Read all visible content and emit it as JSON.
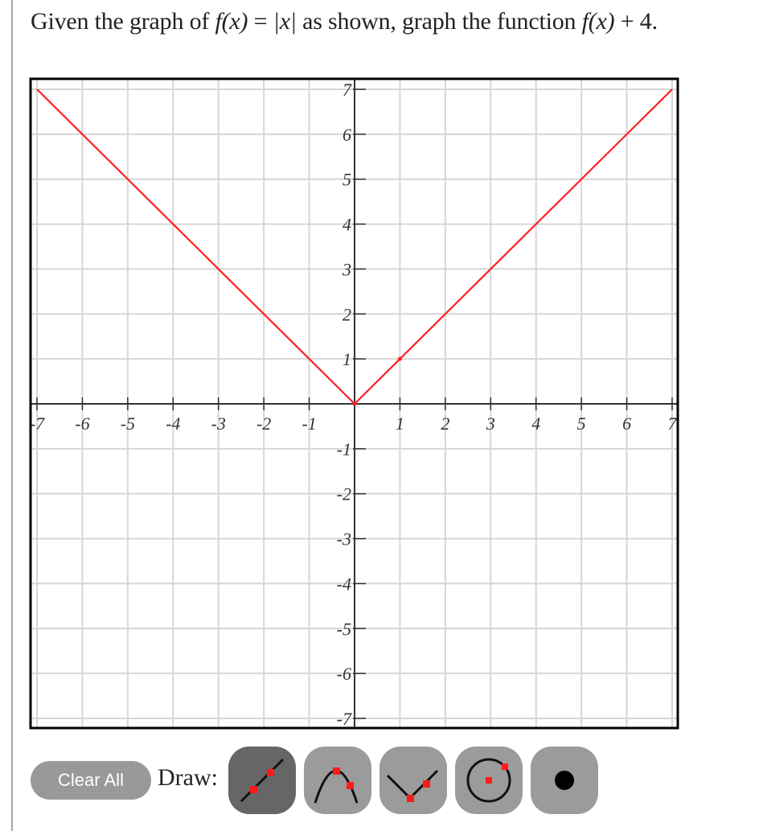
{
  "question": {
    "prefix": "Given the graph of ",
    "f_of_x_1": "f(x)",
    "equals": " = ",
    "abs_x": "|x|",
    "middle": " as shown, graph the function ",
    "f_of_x_2": "f(x)",
    "suffix": " + 4."
  },
  "graph": {
    "x_range": [
      -7,
      7
    ],
    "y_range": [
      -7,
      7
    ],
    "x_tick_labels": [
      "-7",
      "-6",
      "-5",
      "-4",
      "-3",
      "-2",
      "-1",
      "1",
      "2",
      "3",
      "4",
      "5",
      "6",
      "7"
    ],
    "y_tick_labels": [
      "7",
      "6",
      "5",
      "4",
      "3",
      "2",
      "1",
      "-1",
      "-2",
      "-3",
      "-4",
      "-5",
      "-6",
      "-7"
    ],
    "grid": true,
    "colors": {
      "grid": "#d6d6d6",
      "axis": "#333333",
      "frame": "#000000",
      "plot_line": "#ff2020"
    },
    "plotted_function": {
      "type": "absolute-value",
      "vertex": [
        0,
        0
      ],
      "control_point": [
        1,
        1
      ],
      "points": [
        [
          -7,
          7
        ],
        [
          0,
          0
        ],
        [
          7,
          7
        ]
      ]
    }
  },
  "toolbar": {
    "clear_label": "Clear All",
    "draw_label": "Draw:",
    "tools": [
      {
        "name": "line-tool",
        "icon": "line-icon",
        "active": true
      },
      {
        "name": "parabola-tool",
        "icon": "parabola-icon",
        "active": false
      },
      {
        "name": "absolute-value-tool",
        "icon": "absolute-value-icon",
        "active": false
      },
      {
        "name": "circle-tool",
        "icon": "circle-icon",
        "active": false
      },
      {
        "name": "point-tool",
        "icon": "point-icon",
        "active": false
      }
    ]
  }
}
